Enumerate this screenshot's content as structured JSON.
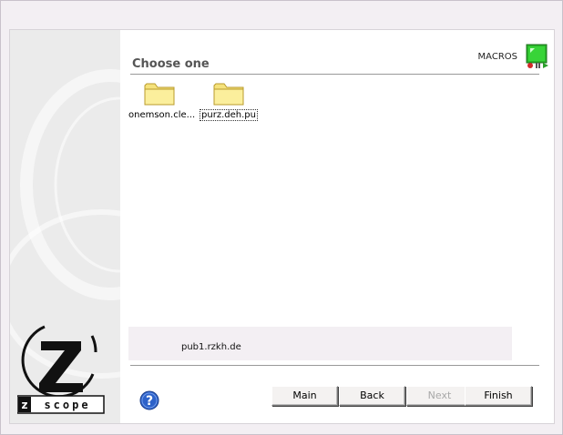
{
  "header": {
    "title": "Choose one",
    "macros_label": "MACROS",
    "macros_icon": "macro-recorder-icon"
  },
  "folders": [
    {
      "label": "onemson.cle...",
      "icon": "folder-icon",
      "selected": false
    },
    {
      "label": "purz.deh.pu",
      "icon": "folder-icon",
      "selected": true
    }
  ],
  "hostbar": {
    "text": "pub1.rzkh.de"
  },
  "sidebar": {
    "logo": "zscope-logo",
    "logo_text": "z scope"
  },
  "buttons": {
    "main": "Main",
    "back": "Back",
    "next": "Next",
    "finish": "Finish"
  },
  "help_icon": "question-mark-icon",
  "colors": {
    "sidebar_bg": "#ebebeb",
    "frame_bg": "#f3eff3",
    "help_blue": "#2d62c9"
  }
}
